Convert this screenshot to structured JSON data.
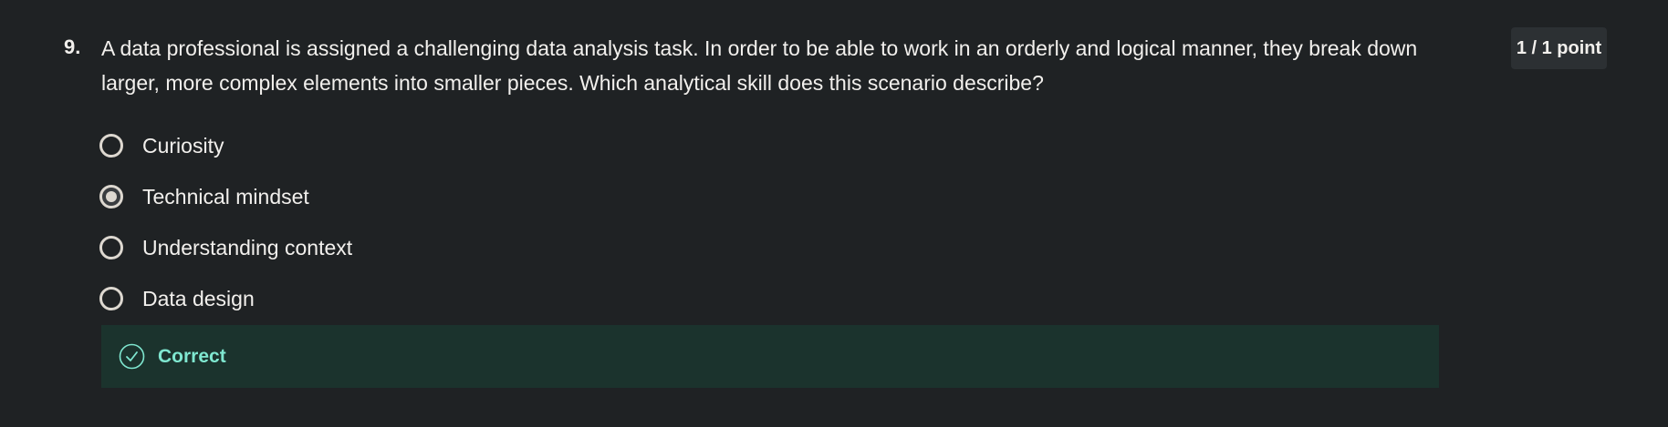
{
  "question": {
    "number": "9.",
    "text": "A data professional is assigned a challenging data analysis task. In order to be able to work in an orderly and logical manner, they break down larger, more complex elements into smaller pieces. Which analytical skill does this scenario describe?",
    "points": "1 / 1 point",
    "options": [
      {
        "label": "Curiosity",
        "selected": false
      },
      {
        "label": "Technical mindset",
        "selected": true
      },
      {
        "label": "Understanding context",
        "selected": false
      },
      {
        "label": "Data design",
        "selected": false
      }
    ],
    "feedback": {
      "label": "Correct",
      "icon": "check-circle-icon",
      "color": "#7fe7d0",
      "background": "#1b332d"
    }
  }
}
